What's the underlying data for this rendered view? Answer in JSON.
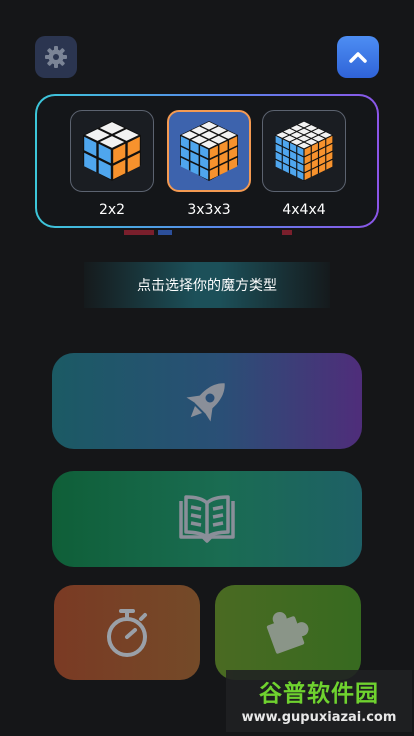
{
  "cube_types": [
    {
      "label": "2x2",
      "grid": 2,
      "selected": false
    },
    {
      "label": "3x3x3",
      "grid": 3,
      "selected": true
    },
    {
      "label": "4x4x4",
      "grid": 4,
      "selected": false
    }
  ],
  "hint": {
    "text": "点击选择你的魔方类型"
  },
  "watermark": {
    "title": "谷普软件园",
    "url": "www.gupuxiazai.com"
  },
  "icons": {
    "settings": "gear-icon",
    "collapse": "chevron-up-icon",
    "speed": "rocket-icon",
    "learn": "book-icon",
    "timer": "stopwatch-icon",
    "puzzle": "puzzle-icon"
  },
  "colors": {
    "cube_blue": "#4fa6ee",
    "cube_orange": "#f7922d",
    "cube_white": "#f2f2f2",
    "selected_border": "#f49a52"
  }
}
